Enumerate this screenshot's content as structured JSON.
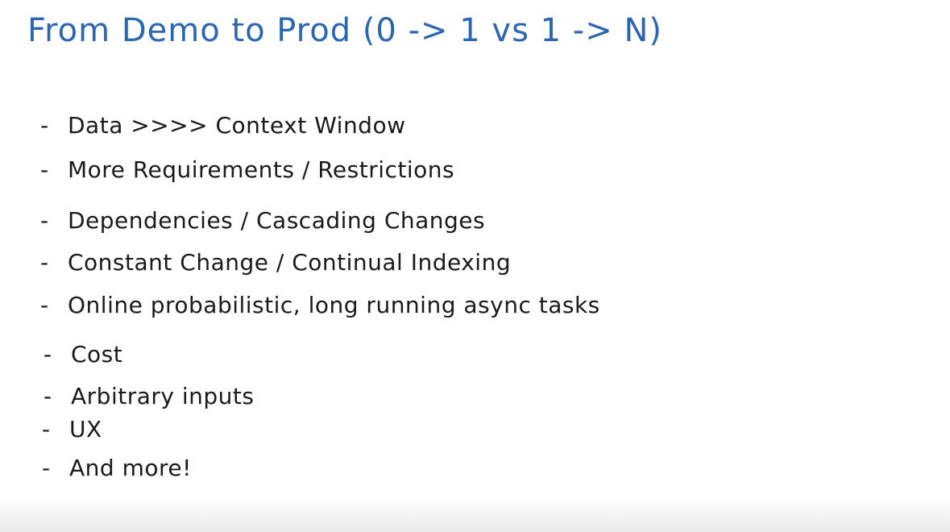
{
  "slide": {
    "title": "From Demo to Prod (0 -> 1 vs 1 -> N)",
    "bullet_marker": "-",
    "items": [
      "Data >>>> Context Window",
      "More Requirements / Restrictions",
      "Dependencies / Cascading Changes",
      "Constant Change / Continual Indexing",
      "Online probabilistic, long running async tasks",
      "Cost",
      "Arbitrary inputs",
      "UX",
      "And more!"
    ],
    "title_color": "#2b66b2",
    "text_color": "#1a1a1a"
  }
}
